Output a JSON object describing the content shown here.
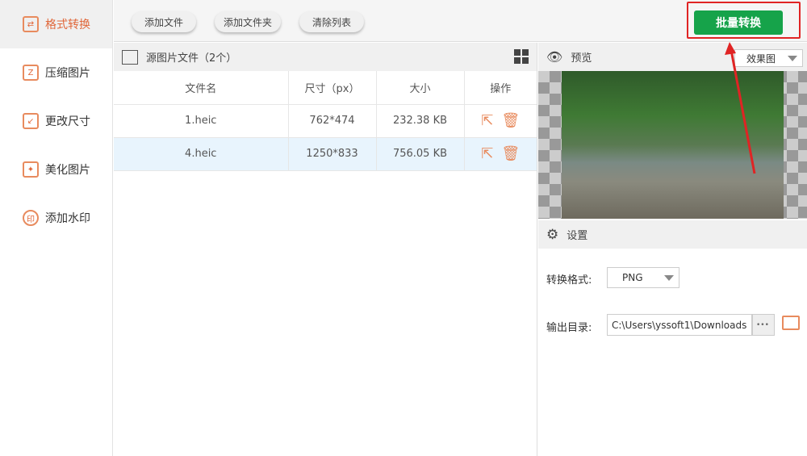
{
  "sidebar": {
    "items": [
      {
        "label": "格式转换",
        "icon": "⇄"
      },
      {
        "label": "压缩图片",
        "icon": "Z"
      },
      {
        "label": "更改尺寸",
        "icon": "↙"
      },
      {
        "label": "美化图片",
        "icon": "✦"
      },
      {
        "label": "添加水印",
        "icon": "印"
      }
    ]
  },
  "toolbar": {
    "add_file": "添加文件",
    "add_folder": "添加文件夹",
    "clear_list": "清除列表",
    "batch_convert": "批量转换"
  },
  "files": {
    "title": "源图片文件（2个）",
    "columns": [
      "文件名",
      "尺寸（px）",
      "大小",
      "操作"
    ],
    "rows": [
      {
        "name": "1.heic",
        "size": "762*474",
        "filesize": "232.38 KB"
      },
      {
        "name": "4.heic",
        "size": "1250*833",
        "filesize": "756.05 KB"
      }
    ]
  },
  "preview": {
    "title": "预览",
    "mode": "效果图"
  },
  "settings": {
    "title": "设置",
    "format_label": "转换格式:",
    "format_value": "PNG",
    "output_label": "输出目录:",
    "output_value": "C:\\Users\\yssoft1\\Downloads",
    "more": "•••"
  },
  "colors": {
    "accent": "#e0673a",
    "convert": "#16a34a",
    "highlight": "#e02424"
  }
}
